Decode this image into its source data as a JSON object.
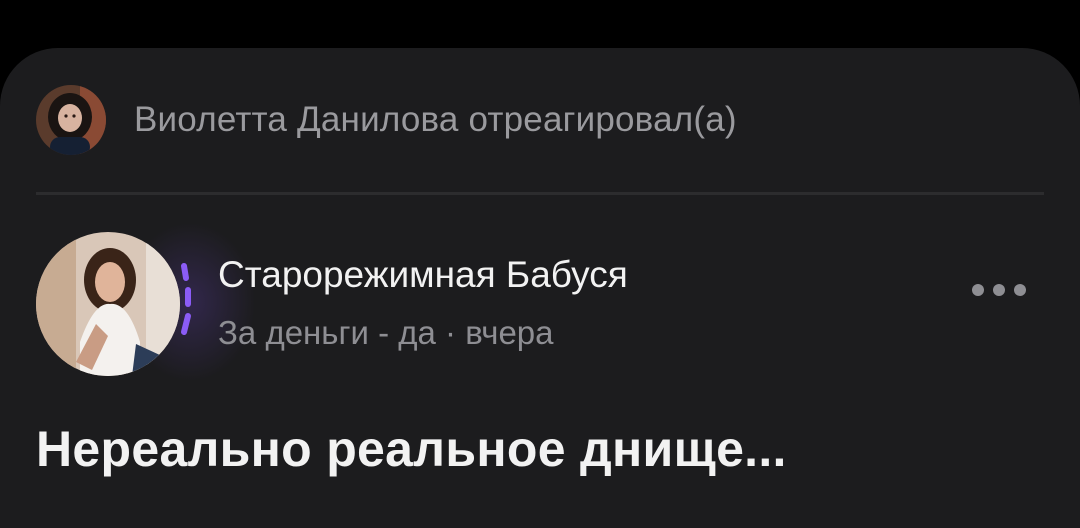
{
  "reaction": {
    "user_name": "Виолетта Данилова",
    "text": "Виолетта Данилова отреагировал(а)",
    "avatar_icon": "user-photo-avatar"
  },
  "post": {
    "group_name": "Старорежимная Бабуся",
    "subtitle": "За деньги - да · вчера",
    "avatar_icon": "group-photo-avatar",
    "more_icon": "more-horizontal-icon",
    "text": "Нереально реальное днище..."
  },
  "colors": {
    "background": "#000000",
    "card": "#1c1c1e",
    "primary_text": "#f2f2f2",
    "secondary_text": "#8e8e93",
    "accent_story_ring": "#8b5cf6"
  }
}
